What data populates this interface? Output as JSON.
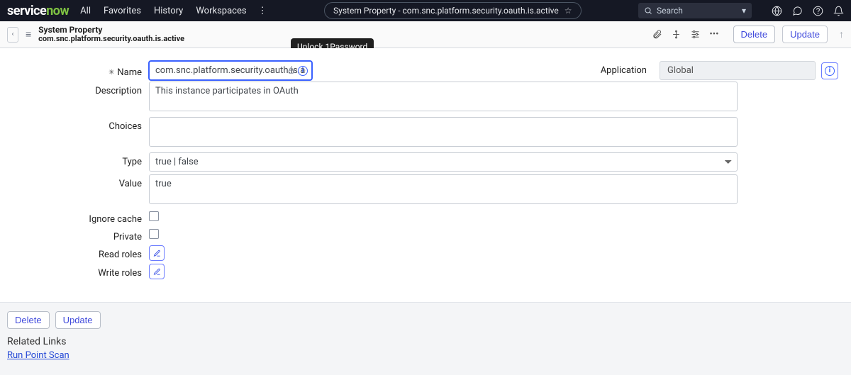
{
  "topnav": {
    "links": [
      "All",
      "Favorites",
      "History",
      "Workspaces"
    ],
    "pill_text": "System Property - com.snc.platform.security.oauth.is.active",
    "search_placeholder": "Search"
  },
  "subbar": {
    "title1": "System Property",
    "title2": "com.snc.platform.security.oauth.is.active",
    "delete": "Delete",
    "update": "Update"
  },
  "tooltip": {
    "text": "Unlock 1Password"
  },
  "form": {
    "name_label": "Name",
    "name_value": "com.snc.platform.security.oauth.is.active",
    "application_label": "Application",
    "application_value": "Global",
    "description_label": "Description",
    "description_value": "This instance participates in OAuth",
    "choices_label": "Choices",
    "choices_value": "",
    "type_label": "Type",
    "type_value": "true | false",
    "value_label": "Value",
    "value_value": "true",
    "ignore_cache_label": "Ignore cache",
    "private_label": "Private",
    "read_roles_label": "Read roles",
    "write_roles_label": "Write roles"
  },
  "bottom": {
    "delete": "Delete",
    "update": "Update",
    "related_links_heading": "Related Links",
    "run_point_scan": "Run Point Scan"
  }
}
